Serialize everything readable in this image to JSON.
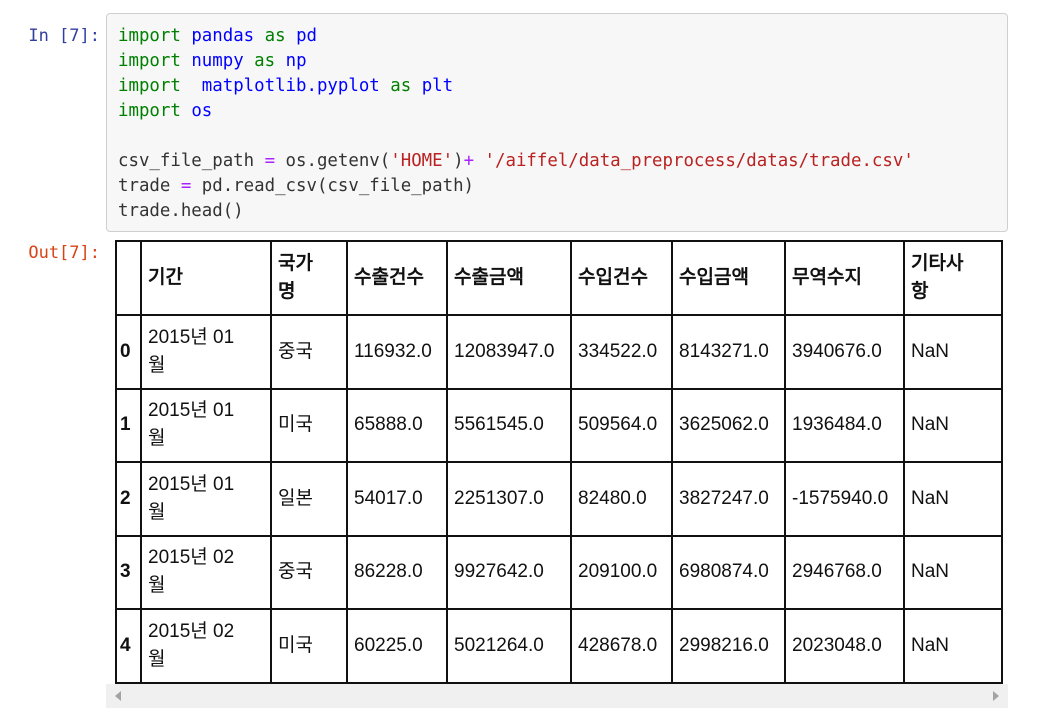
{
  "cell": {
    "in_prompt": "In [7]:",
    "out_prompt": "Out[7]:",
    "code_lines": [
      [
        {
          "t": "import",
          "c": "kw"
        },
        {
          "t": " "
        },
        {
          "t": "pandas",
          "c": "nm"
        },
        {
          "t": " "
        },
        {
          "t": "as",
          "c": "kw"
        },
        {
          "t": " "
        },
        {
          "t": "pd",
          "c": "nm"
        }
      ],
      [
        {
          "t": "import",
          "c": "kw"
        },
        {
          "t": " "
        },
        {
          "t": "numpy",
          "c": "nm"
        },
        {
          "t": " "
        },
        {
          "t": "as",
          "c": "kw"
        },
        {
          "t": " "
        },
        {
          "t": "np",
          "c": "nm"
        }
      ],
      [
        {
          "t": "import",
          "c": "kw"
        },
        {
          "t": "  "
        },
        {
          "t": "matplotlib.pyplot",
          "c": "nm"
        },
        {
          "t": " "
        },
        {
          "t": "as",
          "c": "kw"
        },
        {
          "t": " "
        },
        {
          "t": "plt",
          "c": "nm"
        }
      ],
      [
        {
          "t": "import",
          "c": "kw"
        },
        {
          "t": " "
        },
        {
          "t": "os",
          "c": "nm"
        }
      ],
      [
        {
          "t": ""
        }
      ],
      [
        {
          "t": "csv_file_path "
        },
        {
          "t": "=",
          "c": "op"
        },
        {
          "t": " os.getenv("
        },
        {
          "t": "'HOME'",
          "c": "st"
        },
        {
          "t": ")"
        },
        {
          "t": "+",
          "c": "op"
        },
        {
          "t": " "
        },
        {
          "t": "'/aiffel/data_preprocess/datas/trade.csv'",
          "c": "st"
        }
      ],
      [
        {
          "t": "trade "
        },
        {
          "t": "=",
          "c": "op"
        },
        {
          "t": " pd.read_csv(csv_file_path)"
        }
      ],
      [
        {
          "t": "trade.head()"
        }
      ]
    ]
  },
  "table": {
    "columns": [
      {
        "line1": "기간",
        "line2": ""
      },
      {
        "line1": "국가",
        "line2": "명"
      },
      {
        "line1": "수출건수",
        "line2": ""
      },
      {
        "line1": "수출금액",
        "line2": ""
      },
      {
        "line1": "수입건수",
        "line2": ""
      },
      {
        "line1": "수입금액",
        "line2": ""
      },
      {
        "line1": "무역수지",
        "line2": ""
      },
      {
        "line1": "기타사",
        "line2": "항"
      }
    ],
    "rows": [
      {
        "index": "0",
        "period1": "2015년 01",
        "period2": "월",
        "country": "중국",
        "exp_cnt": "116932.0",
        "exp_amt": "12083947.0",
        "imp_cnt": "334522.0",
        "imp_amt": "8143271.0",
        "balance": "3940676.0",
        "etc": "NaN"
      },
      {
        "index": "1",
        "period1": "2015년 01",
        "period2": "월",
        "country": "미국",
        "exp_cnt": "65888.0",
        "exp_amt": "5561545.0",
        "imp_cnt": "509564.0",
        "imp_amt": "3625062.0",
        "balance": "1936484.0",
        "etc": "NaN"
      },
      {
        "index": "2",
        "period1": "2015년 01",
        "period2": "월",
        "country": "일본",
        "exp_cnt": "54017.0",
        "exp_amt": "2251307.0",
        "imp_cnt": "82480.0",
        "imp_amt": "3827247.0",
        "balance": "-1575940.0",
        "etc": "NaN"
      },
      {
        "index": "3",
        "period1": "2015년 02",
        "period2": "월",
        "country": "중국",
        "exp_cnt": "86228.0",
        "exp_amt": "9927642.0",
        "imp_cnt": "209100.0",
        "imp_amt": "6980874.0",
        "balance": "2946768.0",
        "etc": "NaN"
      },
      {
        "index": "4",
        "period1": "2015년 02",
        "period2": "월",
        "country": "미국",
        "exp_cnt": "60225.0",
        "exp_amt": "5021264.0",
        "imp_cnt": "428678.0",
        "imp_amt": "2998216.0",
        "balance": "2023048.0",
        "etc": "NaN"
      }
    ]
  },
  "scrollbar": {
    "left_arrow_icon": "triangle-left-icon",
    "right_arrow_icon": "triangle-right-icon"
  },
  "colors": {
    "in_prompt": "#303f9f",
    "out_prompt": "#d84315",
    "keyword": "#008000",
    "name": "#0000ff",
    "string": "#ba2121",
    "operator": "#aa22ff"
  }
}
